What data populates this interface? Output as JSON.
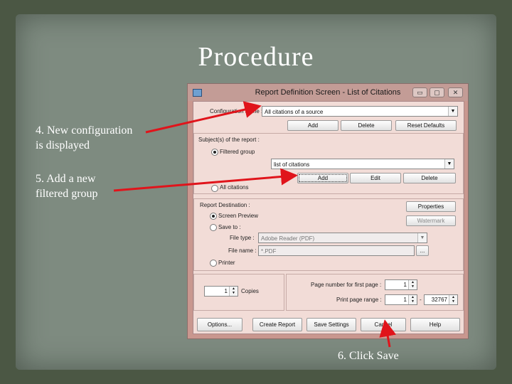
{
  "slide": {
    "title": "Procedure",
    "notes": {
      "n4_line1": "4.  New configuration",
      "n4_line2": "is displayed",
      "n5_line1": "5.  Add a new",
      "n5_line2": "filtered group",
      "n6": "6.  Click Save"
    }
  },
  "dialog": {
    "title": "Report Definition Screen - List of Citations",
    "config_label": "Configuration name :",
    "config_value": "All citations of a source",
    "config_buttons": {
      "add": "Add",
      "delete": "Delete",
      "reset": "Reset Defaults"
    },
    "subjects_label": "Subject(s) of the report :",
    "filtered_group_label": "Filtered group",
    "filtered_group_value": "list of citations",
    "group_buttons": {
      "add": "Add",
      "edit": "Edit",
      "delete": "Delete"
    },
    "all_citations_label": "All citations",
    "destination_label": "Report Destination :",
    "screen_preview_label": "Screen Preview",
    "save_to_label": "Save to :",
    "file_type_label": "File type :",
    "file_type_value": "Adobe Reader (PDF)",
    "file_name_label": "File name :",
    "file_name_value": "*.PDF",
    "browse": "...",
    "printer_label": "Printer",
    "properties": "Properties",
    "watermark": "Watermark",
    "copies_value": "1",
    "copies_label": "Copies",
    "first_page_label": "Page number for first page :",
    "first_page_value": "1",
    "range_label": "Print page range :",
    "range_from": "1",
    "range_sep": "-",
    "range_to": "32767",
    "bottom_buttons": {
      "options": "Options...",
      "create": "Create Report",
      "save": "Save Settings",
      "cancel": "Cancel",
      "help": "Help"
    },
    "window_buttons": {
      "minimize": "▭",
      "maximize": "▢",
      "close": "✕"
    }
  },
  "colors": {
    "background": "#4b5744",
    "slide_panel": "#7e8b80",
    "dialog_frame": "#c9978f",
    "annotation_arrow": "#e0141b"
  }
}
